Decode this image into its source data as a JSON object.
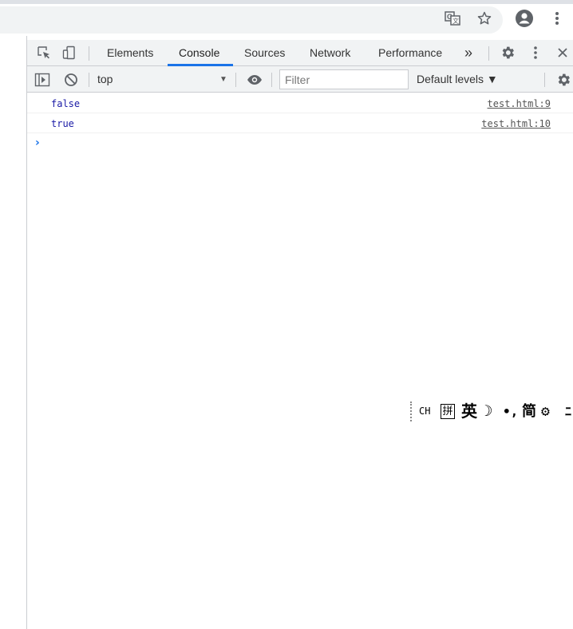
{
  "browser": {
    "icons": {
      "translate": "translate-icon",
      "bookmark": "star-icon",
      "profile": "account-circle-icon",
      "menu": "more-vert-icon"
    }
  },
  "devtools": {
    "tabs": [
      {
        "label": "Elements"
      },
      {
        "label": "Console"
      },
      {
        "label": "Sources"
      },
      {
        "label": "Network"
      },
      {
        "label": "Performance"
      }
    ],
    "more_tabs_label": "»",
    "active_tab": "Console",
    "accent": "#1a73e8"
  },
  "console_toolbar": {
    "context": "top",
    "filter_placeholder": "Filter",
    "levels_label": "Default levels ▼"
  },
  "console": {
    "messages": [
      {
        "text": "false",
        "source": "test.html:9"
      },
      {
        "text": "true",
        "source": "test.html:10"
      }
    ],
    "prompt_symbol": "›"
  },
  "ime_toolbar": {
    "mode": "CH",
    "pinyin": "拼",
    "lang": "英",
    "moon": "☽",
    "punct": "•,",
    "simplified": "简",
    "settings": "⚙",
    "more": "ﾆ"
  }
}
